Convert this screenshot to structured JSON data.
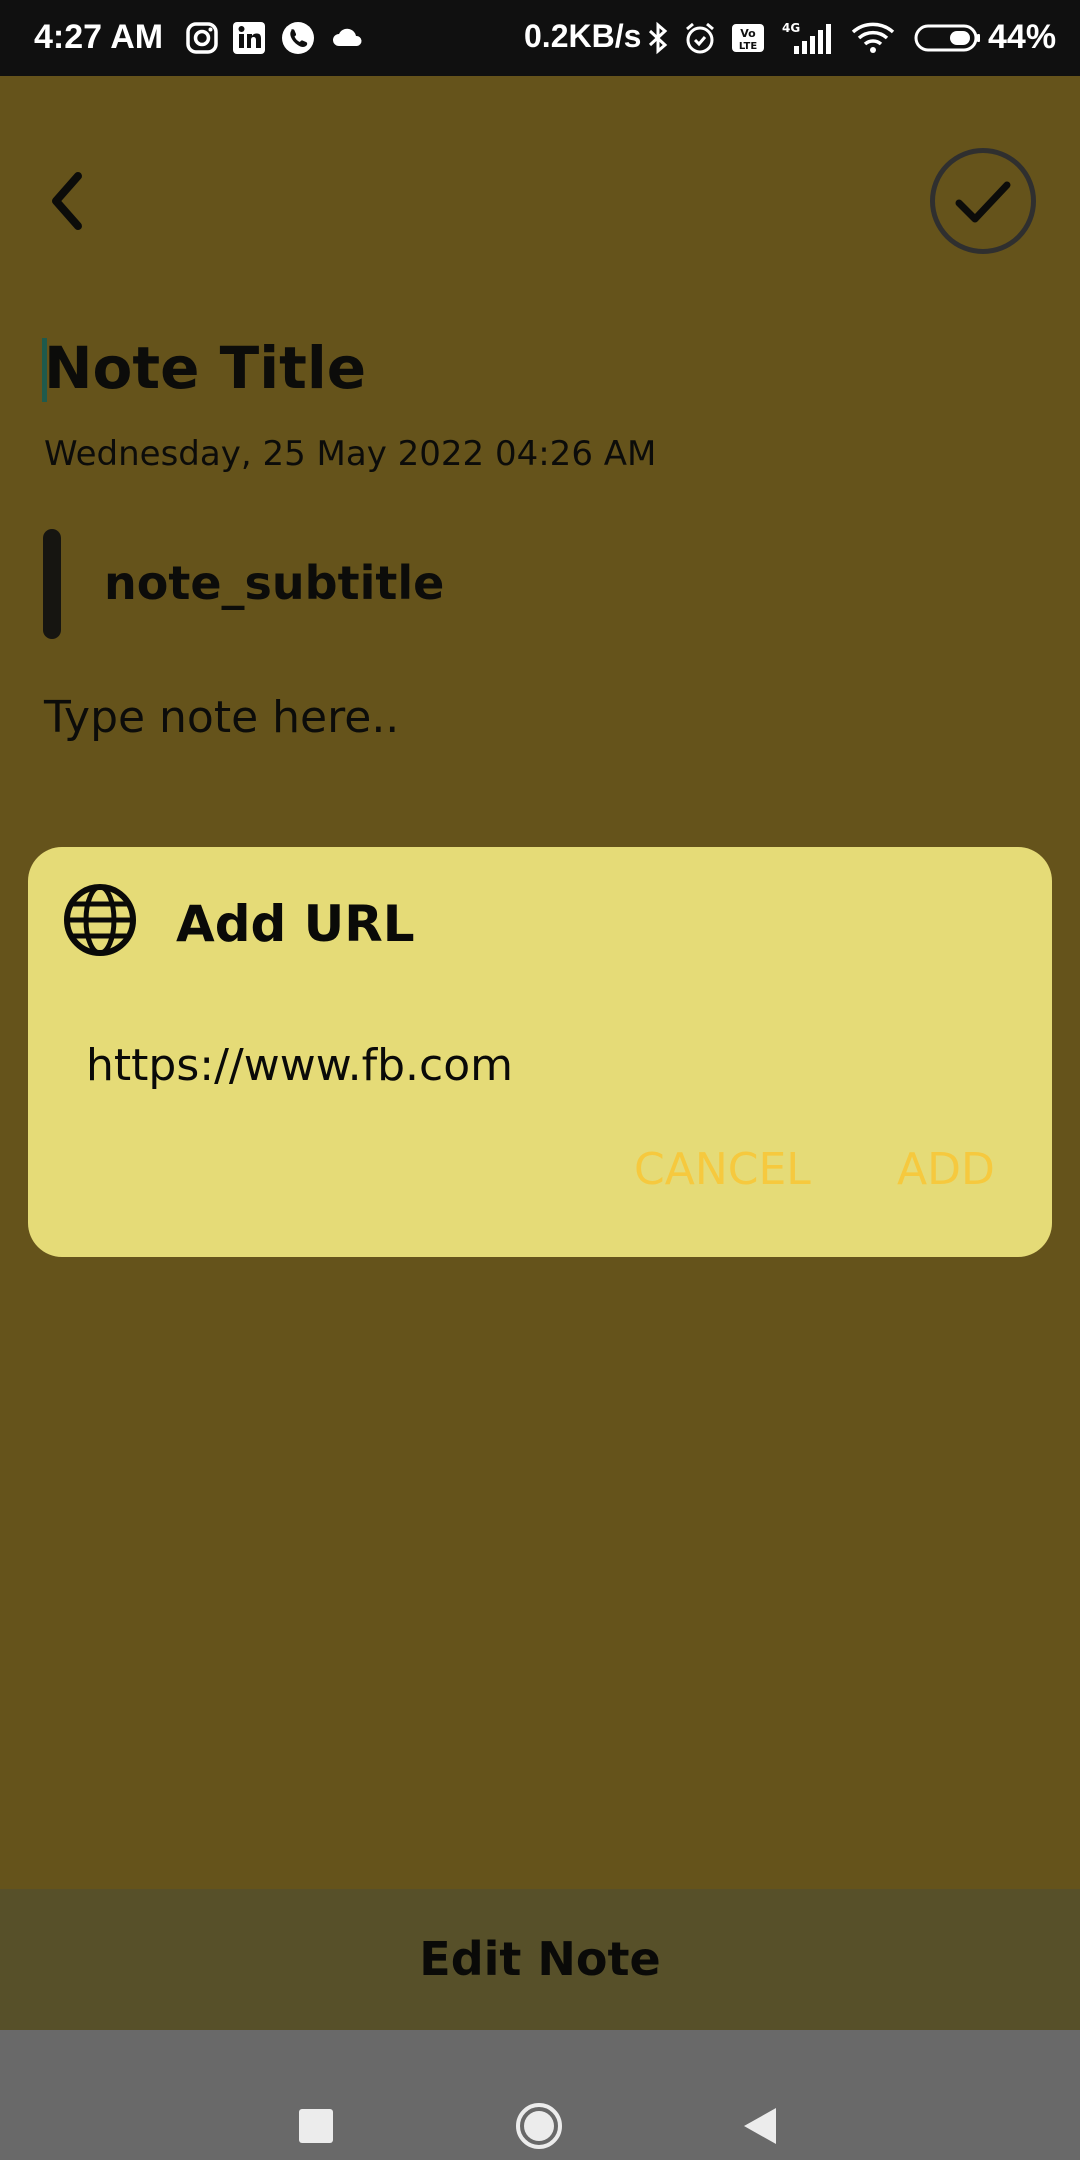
{
  "status_bar": {
    "time": "4:27 AM",
    "net_speed": "0.2KB/s",
    "battery": "44%",
    "icons": [
      "instagram-icon",
      "linkedin-icon",
      "whatsapp-icon",
      "cloud-icon",
      "bluetooth-icon",
      "alarm-icon",
      "volte-icon",
      "signal-icon",
      "wifi-icon",
      "battery-icon"
    ]
  },
  "header": {
    "back_icon": "chevron-left-icon",
    "save_icon": "check-icon"
  },
  "note": {
    "title": "Note Title",
    "datetime": "Wednesday, 25 May 2022 04:26 AM",
    "subtitle": "note_subtitle",
    "body_placeholder": "Type note here.."
  },
  "dialog": {
    "icon": "globe-icon",
    "title": "Add URL",
    "url_value": "https://www.fb.com",
    "cancel_label": "CANCEL",
    "add_label": "ADD"
  },
  "bottom_bar": {
    "label": "Edit Note"
  },
  "colors": {
    "background": "#65531b",
    "dialog": "#e5db77",
    "accent": "#f6c93e",
    "bottom_bar": "#575029"
  }
}
